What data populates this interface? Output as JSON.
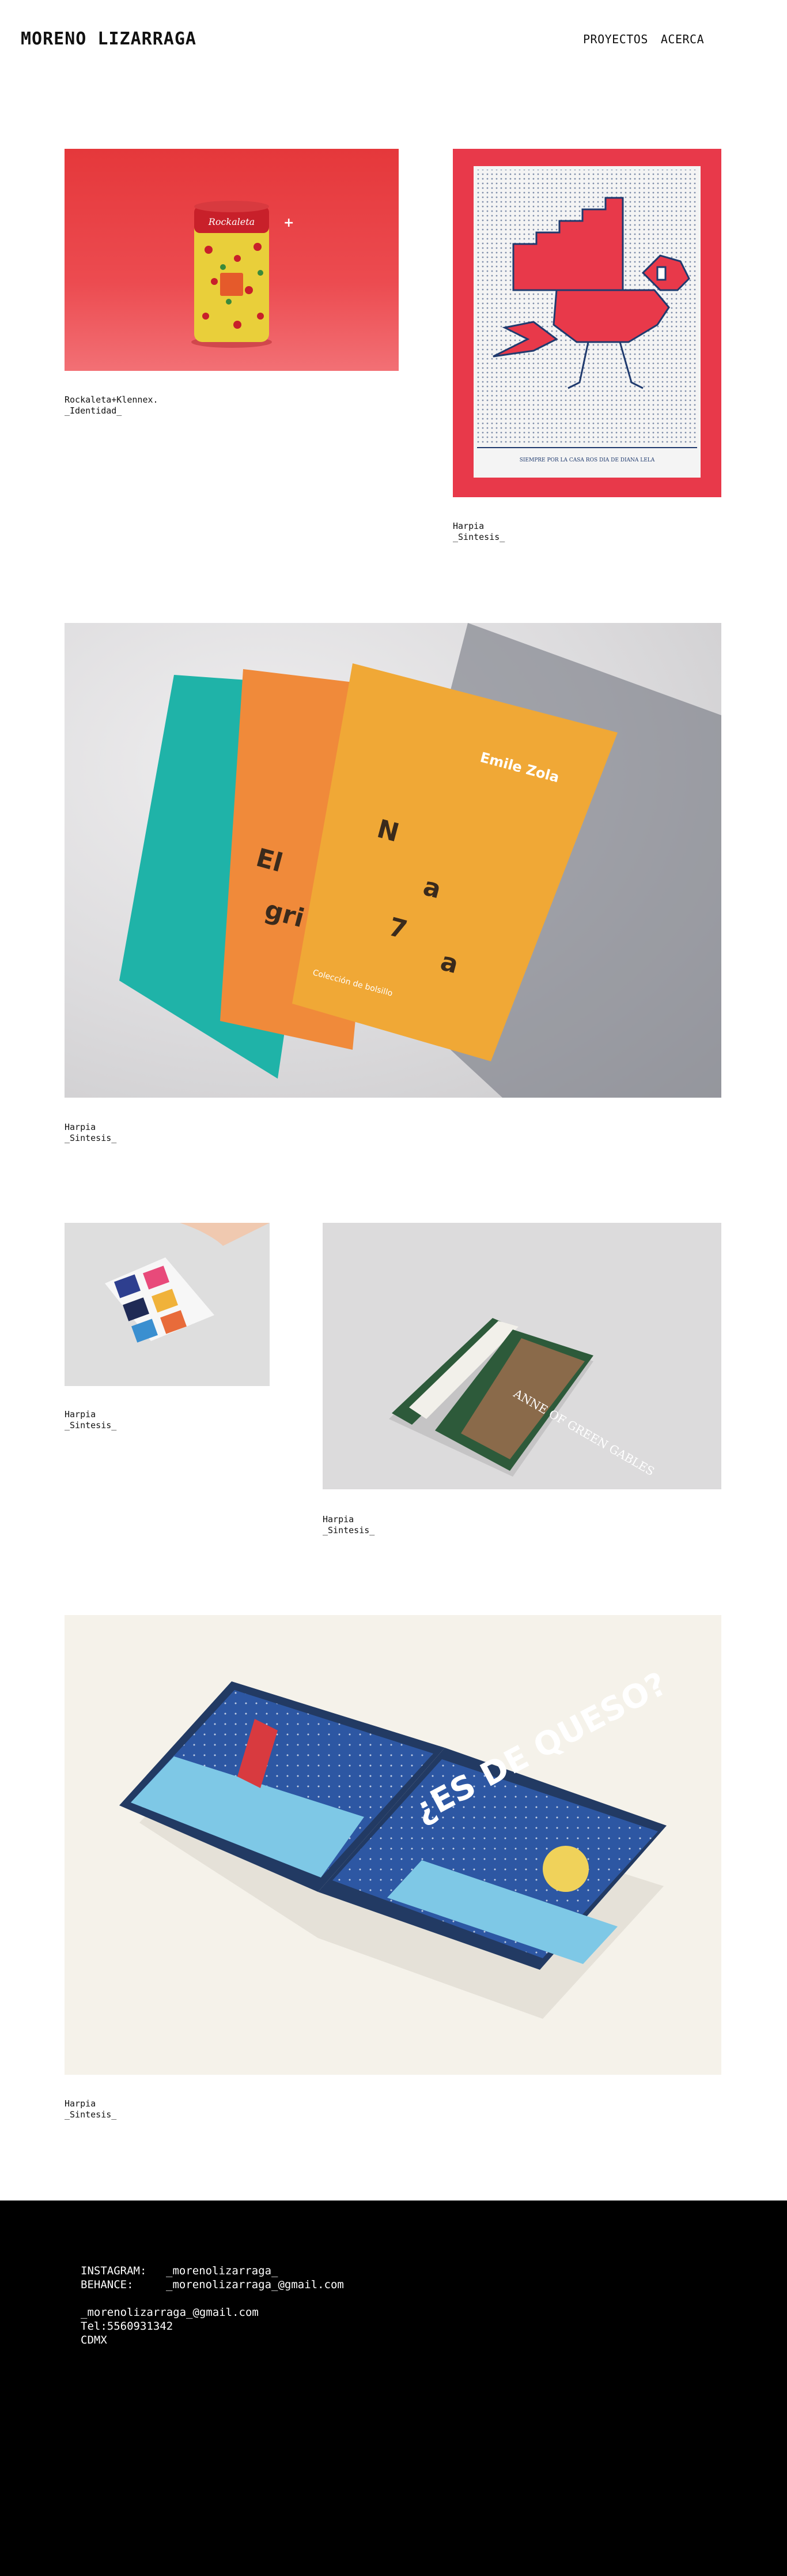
{
  "header": {
    "logo": "MORENO LIZARRAGA",
    "nav": [
      "PROYECTOS",
      "ACERCA"
    ]
  },
  "projects": [
    {
      "title": "Rockaleta+Klennex.",
      "subtitle": "_Identidad_"
    },
    {
      "title": "Harpia",
      "subtitle": "_Sintesis_",
      "poster_text": "SIEMPRE POR LA CASA ROS DIA DE DIANA LELA"
    },
    {
      "title": "Harpia",
      "subtitle": "_Sintesis_",
      "book_author": "Emile Zola",
      "book_series": "Colección de bolsillo"
    },
    {
      "title": "Harpia",
      "subtitle": "_Sintesis_"
    },
    {
      "title": "Harpia",
      "subtitle": "_Sintesis_",
      "book_text": "ANNE OF GREEN GABLES"
    },
    {
      "title": "Harpia",
      "subtitle": "_Sintesis_",
      "book_text": "¿ES DE QUESO?"
    }
  ],
  "footer": {
    "instagram_label": "INSTAGRAM:",
    "instagram_value": "_morenolizarraga_",
    "behance_label": "BEHANCE:",
    "behance_value": "_morenolizarraga_@gmail.com",
    "email": "_morenolizarraga_@gmail.com",
    "tel": "Tel:5560931342",
    "city": "CDMX"
  },
  "colors": {
    "accent_red": "#e8394a",
    "navy": "#1f3a6e",
    "footer_bg": "#000000"
  }
}
